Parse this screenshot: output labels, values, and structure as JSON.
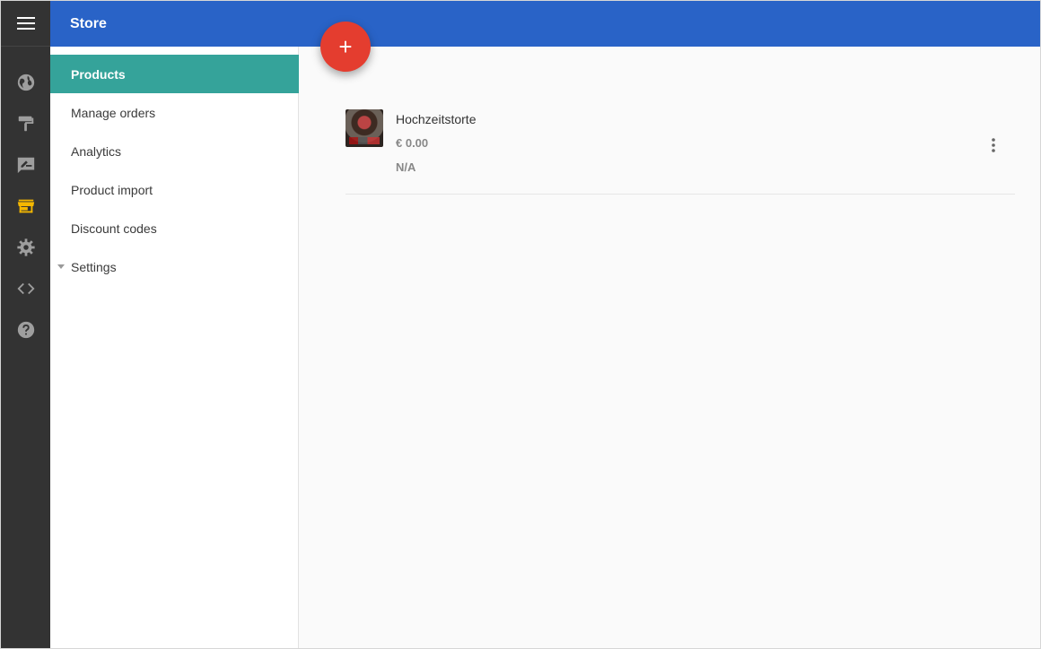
{
  "app": {
    "title": "Store"
  },
  "rail": {
    "icons": [
      "menu-icon",
      "globe-icon",
      "paint-roller-icon",
      "edit-note-icon",
      "store-icon",
      "gear-icon",
      "code-icon",
      "help-icon"
    ],
    "active": "store-icon",
    "active_color": "#f5b800",
    "icon_color": "#9e9e9e"
  },
  "sidebar": {
    "items": [
      {
        "label": "Products",
        "active": true
      },
      {
        "label": "Manage orders"
      },
      {
        "label": "Analytics"
      },
      {
        "label": "Product import"
      },
      {
        "label": "Discount codes"
      },
      {
        "label": "Settings",
        "expandable": true
      }
    ]
  },
  "main": {
    "fab_label": "+",
    "products": [
      {
        "name": "Hochzeitstorte",
        "price": "€ 0.00",
        "stock": "N/A"
      }
    ]
  },
  "colors": {
    "topbar": "#2963c7",
    "active_nav": "#35a39a",
    "fab": "#e43d2f",
    "rail": "#333333"
  }
}
